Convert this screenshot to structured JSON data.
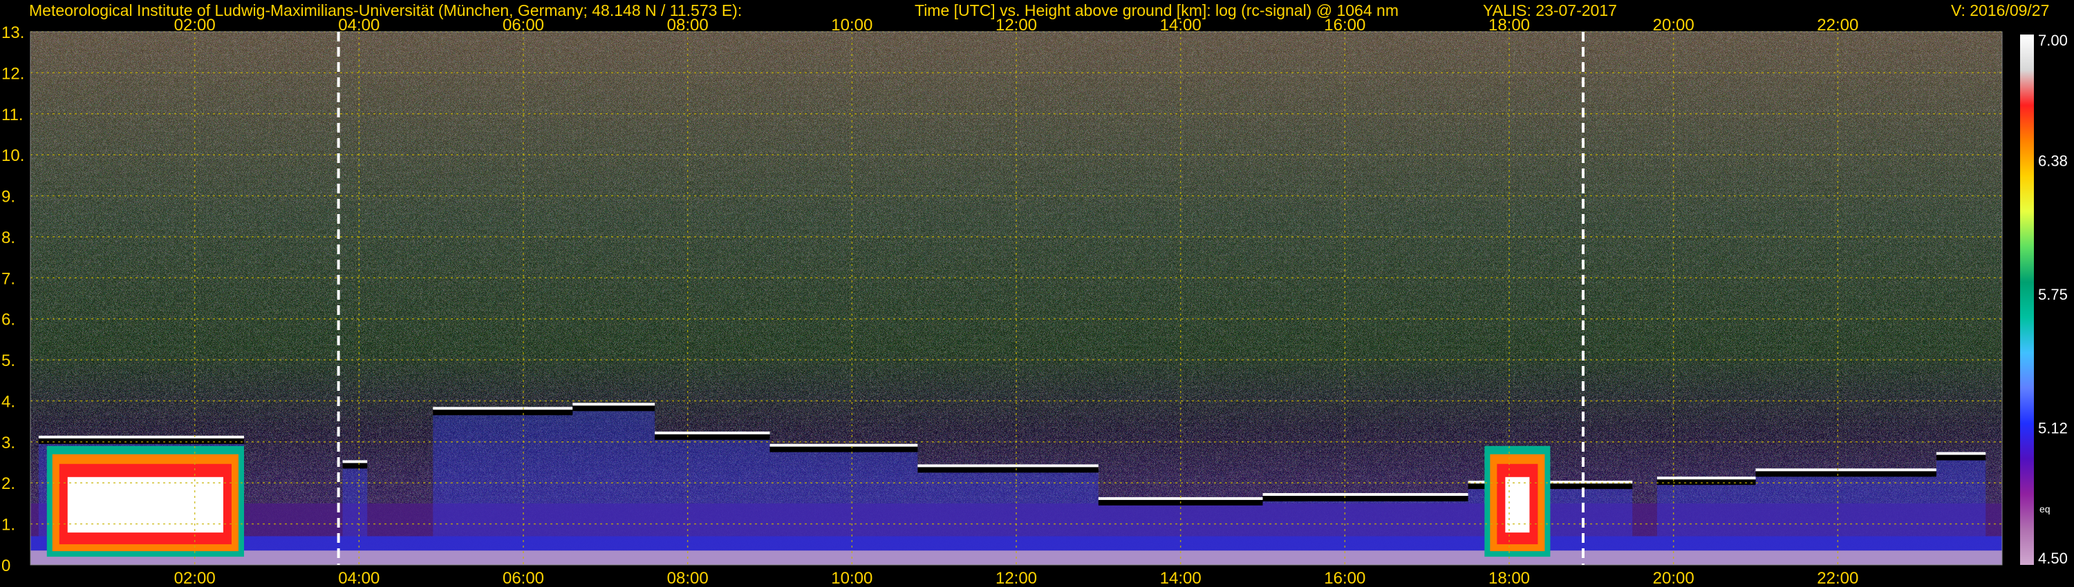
{
  "header": {
    "institute": "Meteorological Institute of Ludwig-Maximilians-Universität (München, Germany; 48.148 N / 11.573 E):",
    "quantity": "Time [UTC] vs. Height above ground [km]: log (rc-signal) @ 1064 nm",
    "station_date": "YALIS: 23-07-2017",
    "version": "V: 2016/09/27"
  },
  "chart_data": {
    "type": "heatmap",
    "title": "Time [UTC] vs. Height above ground [km]: log (rc-signal) @ 1064 nm",
    "x_ticks": [
      "02:00",
      "04:00",
      "06:00",
      "08:00",
      "10:00",
      "12:00",
      "14:00",
      "16:00",
      "18:00",
      "20:00",
      "22:00"
    ],
    "x_tick_hours": [
      2,
      4,
      6,
      8,
      10,
      12,
      14,
      16,
      18,
      20,
      22
    ],
    "xlim_hours": [
      0.0,
      24.0
    ],
    "y_ticks": [
      "0",
      "1.",
      "2.",
      "3.",
      "4.",
      "5.",
      "6.",
      "7.",
      "8.",
      "9.",
      "10.",
      "11.",
      "12.",
      "13."
    ],
    "ylim_km": [
      0,
      13
    ],
    "grid": true,
    "dashed_marker_hours": [
      3.75,
      18.9
    ],
    "colorbar": {
      "labels": [
        "7.00",
        "6.38",
        "5.75",
        "5.12",
        "4.50"
      ],
      "values": [
        7.0,
        6.38,
        5.75,
        5.12,
        4.5
      ],
      "range": [
        4.5,
        7.0
      ],
      "note": "eq",
      "colors": [
        "#ffffff",
        "#d8d8d8",
        "#ff2020",
        "#ff8000",
        "#ffd000",
        "#e8ff40",
        "#60e060",
        "#00a070",
        "#00c0a0",
        "#40c0ff",
        "#6080ff",
        "#2030ff",
        "#5010c0",
        "#9020a0",
        "#b070b0",
        "#d0a8d0"
      ]
    },
    "cloud_top_km": [
      {
        "start": 0.1,
        "end": 2.6,
        "top": 3.0
      },
      {
        "start": 3.8,
        "end": 4.1,
        "top": 2.4
      },
      {
        "start": 4.9,
        "end": 6.6,
        "top": 3.7
      },
      {
        "start": 6.6,
        "end": 7.6,
        "top": 3.8
      },
      {
        "start": 7.6,
        "end": 9.0,
        "top": 3.1
      },
      {
        "start": 9.0,
        "end": 10.8,
        "top": 2.8
      },
      {
        "start": 10.8,
        "end": 13.0,
        "top": 2.3
      },
      {
        "start": 13.0,
        "end": 15.0,
        "top": 1.5
      },
      {
        "start": 15.0,
        "end": 17.5,
        "top": 1.6
      },
      {
        "start": 17.5,
        "end": 19.5,
        "top": 1.9
      },
      {
        "start": 19.8,
        "end": 21.0,
        "top": 2.0
      },
      {
        "start": 21.0,
        "end": 23.2,
        "top": 2.2
      },
      {
        "start": 23.2,
        "end": 23.8,
        "top": 2.6
      }
    ],
    "dense_aerosol_hours": [
      [
        0.2,
        2.6
      ],
      [
        17.7,
        18.5
      ]
    ]
  }
}
